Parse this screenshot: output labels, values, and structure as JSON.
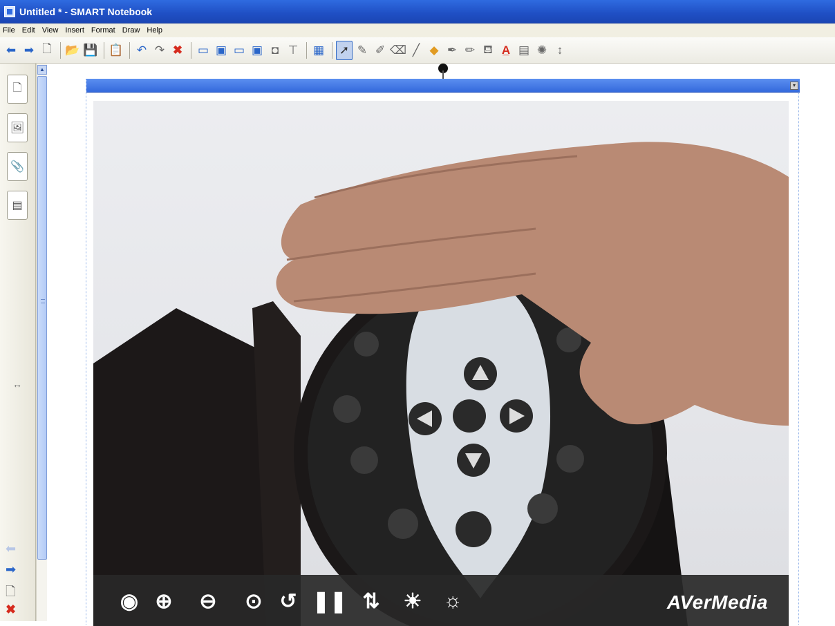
{
  "window": {
    "title": "Untitled * - SMART Notebook"
  },
  "menu": [
    "File",
    "Edit",
    "View",
    "Insert",
    "Format",
    "Draw",
    "Help"
  ],
  "toolbar": {
    "icons": [
      "back-arrow-icon",
      "forward-arrow-icon",
      "add-page-icon",
      "open-folder-icon",
      "save-icon",
      "paste-icon",
      "undo-icon",
      "redo-icon",
      "delete-icon",
      "screen-shade-icon",
      "full-screen-icon",
      "dual-page-icon",
      "capture-icon",
      "document-camera-icon",
      "table-icon",
      "select-arrow-icon",
      "pen-icon",
      "creative-pen-icon",
      "eraser-icon",
      "line-icon",
      "shapes-icon",
      "magic-pen-icon",
      "shape-recognition-icon",
      "fill-icon",
      "text-icon",
      "properties-icon",
      "more-tools-icon"
    ]
  },
  "sidebar": {
    "tabs": [
      "page-sorter-icon",
      "gallery-icon",
      "attachments-icon",
      "properties-icon"
    ],
    "divider_handle": "↔"
  },
  "widget": {
    "menu_glyph": "▾",
    "controls": [
      "eye-icon",
      "zoom-in-icon",
      "zoom-out-icon",
      "zoom-reset-icon",
      "rotate-icon",
      "pause-icon",
      "flip-icon",
      "brightness-up-icon",
      "brightness-down-icon"
    ],
    "control_glyphs": [
      "◉",
      "⊕",
      "⊖",
      "⊙",
      "↺",
      "❚❚",
      "⇅",
      "☀",
      "☼"
    ],
    "brand": "AVerMedia"
  },
  "colors": {
    "title_bar": "#1f4fc4",
    "widget_header": "#4a7fe8",
    "control_bar": "#282828",
    "delete_red": "#d62b1e"
  }
}
